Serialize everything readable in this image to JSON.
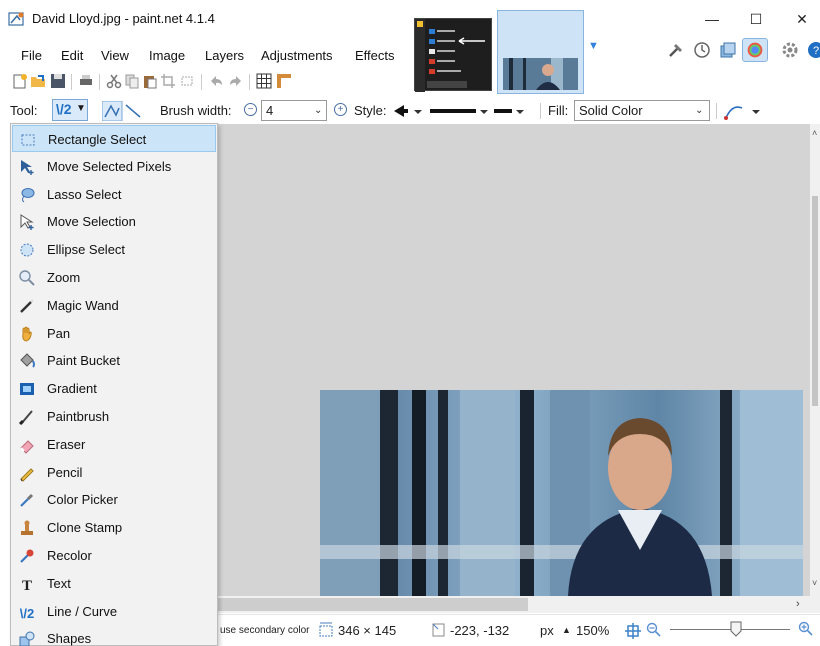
{
  "window": {
    "title": "David Lloyd.jpg - paint.net 4.1.4"
  },
  "menu": [
    "File",
    "Edit",
    "View",
    "Image",
    "Layers",
    "Adjustments",
    "Effects"
  ],
  "toolbar": {
    "tool_label": "Tool:",
    "tool_glyph": "\\/2",
    "brush_width_label": "Brush width:",
    "brush_width_value": "4",
    "style_label": "Style:",
    "fill_label": "Fill:",
    "fill_value": "Solid Color"
  },
  "tools": [
    {
      "label": "Rectangle Select",
      "icon": "rectangle-select-icon",
      "selected": true
    },
    {
      "label": "Move Selected Pixels",
      "icon": "move-pixels-icon"
    },
    {
      "label": "Lasso Select",
      "icon": "lasso-icon"
    },
    {
      "label": "Move Selection",
      "icon": "move-selection-icon"
    },
    {
      "label": "Ellipse Select",
      "icon": "ellipse-select-icon"
    },
    {
      "label": "Zoom",
      "icon": "zoom-icon"
    },
    {
      "label": "Magic Wand",
      "icon": "magic-wand-icon"
    },
    {
      "label": "Pan",
      "icon": "pan-hand-icon"
    },
    {
      "label": "Paint Bucket",
      "icon": "paint-bucket-icon"
    },
    {
      "label": "Gradient",
      "icon": "gradient-icon"
    },
    {
      "label": "Paintbrush",
      "icon": "paintbrush-icon"
    },
    {
      "label": "Eraser",
      "icon": "eraser-icon"
    },
    {
      "label": "Pencil",
      "icon": "pencil-icon"
    },
    {
      "label": "Color Picker",
      "icon": "color-picker-icon"
    },
    {
      "label": "Clone Stamp",
      "icon": "clone-stamp-icon"
    },
    {
      "label": "Recolor",
      "icon": "recolor-icon"
    },
    {
      "label": "Text",
      "icon": "text-icon"
    },
    {
      "label": "Line / Curve",
      "icon": "line-curve-icon"
    },
    {
      "label": "Shapes",
      "icon": "shapes-icon"
    }
  ],
  "status": {
    "hint": "use secondary color",
    "selection_size": "346 × 145",
    "cursor_pos": "-223, -132",
    "unit": "px",
    "zoom": "150%"
  }
}
